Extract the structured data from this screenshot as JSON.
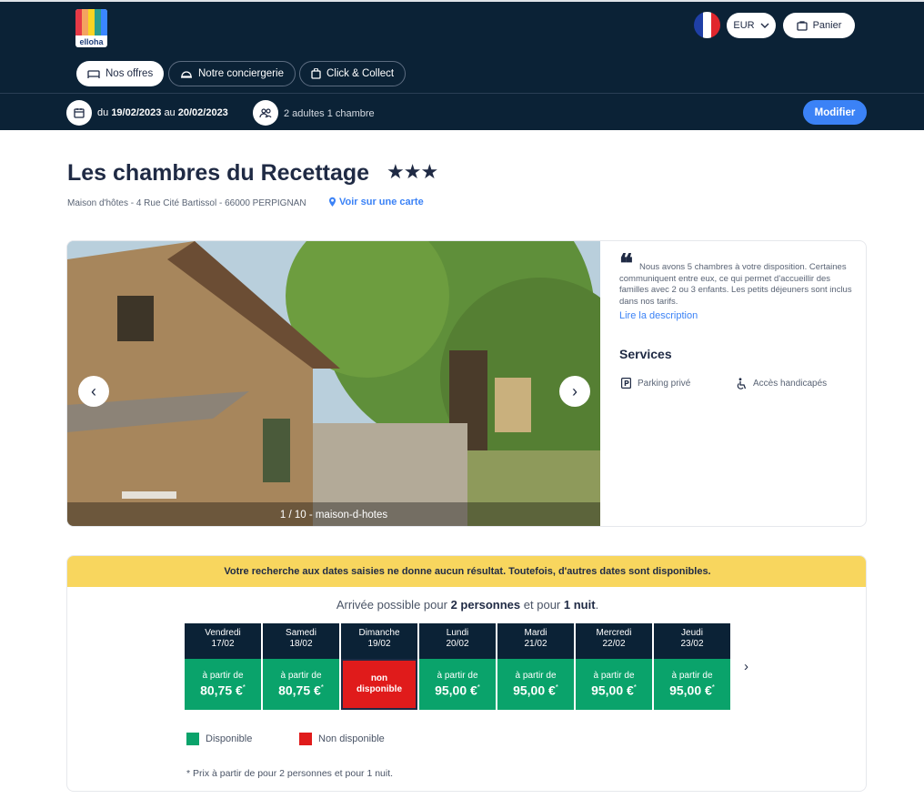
{
  "header": {
    "logo_text": "elloha",
    "currency": "EUR",
    "cart_label": "Panier",
    "nav": [
      {
        "label": "Nos offres"
      },
      {
        "label": "Notre conciergerie"
      },
      {
        "label": "Click & Collect"
      }
    ],
    "search": {
      "date_prefix": "du",
      "date_from": "19/02/2023",
      "date_sep": "au",
      "date_to": "20/02/2023",
      "guests": "2 adultes 1 chambre",
      "modify_label": "Modifier"
    }
  },
  "property": {
    "name": "Les chambres du Recettage",
    "stars": "★★★",
    "address": "Maison d'hôtes - 4 Rue Cité Bartissol - 66000 PERPIGNAN",
    "map_link": "Voir sur une carte",
    "photo_caption": "1 / 10 - maison-d-hotes",
    "description": "Nous avons 5 chambres à votre disposition. Certaines communiquent entre eux, ce qui permet d'accueillir des familles avec 2 ou 3 enfants. Les petits déjeuners sont inclus dans nos tarifs.",
    "read_more": "Lire la description",
    "services_title": "Services",
    "services": [
      {
        "label": "Parking privé",
        "icon": "parking-icon"
      },
      {
        "label": "Accès handicapés",
        "icon": "accessibility-icon"
      }
    ]
  },
  "availability": {
    "banner": "Votre recherche aux dates saisies ne donne aucun résultat. Toutefois, d'autres dates sont disponibles.",
    "arrival_prefix": "Arrivée possible pour",
    "arrival_people": "2 personnes",
    "arrival_mid": "et pour",
    "arrival_nights": "1 nuit",
    "arrival_suffix": ".",
    "days": [
      {
        "weekday": "Vendredi",
        "date": "17/02",
        "from": "à partir de",
        "price": "80,75 €",
        "mark": "*",
        "available": true
      },
      {
        "weekday": "Samedi",
        "date": "18/02",
        "from": "à partir de",
        "price": "80,75 €",
        "mark": "*",
        "available": true
      },
      {
        "weekday": "Dimanche",
        "date": "19/02",
        "na_line1": "non",
        "na_line2": "disponible",
        "available": false
      },
      {
        "weekday": "Lundi",
        "date": "20/02",
        "from": "à partir de",
        "price": "95,00 €",
        "mark": "*",
        "available": true
      },
      {
        "weekday": "Mardi",
        "date": "21/02",
        "from": "à partir de",
        "price": "95,00 €",
        "mark": "*",
        "available": true
      },
      {
        "weekday": "Mercredi",
        "date": "22/02",
        "from": "à partir de",
        "price": "95,00 €",
        "mark": "*",
        "available": true
      },
      {
        "weekday": "Jeudi",
        "date": "23/02",
        "from": "à partir de",
        "price": "95,00 €",
        "mark": "*",
        "available": true
      }
    ],
    "legend_available": "Disponible",
    "legend_unavailable": "Non disponible",
    "footnote": "* Prix à partir de pour 2 personnes et pour 1 nuit.",
    "colors": {
      "available": "#0aa36b",
      "unavailable": "#e01b1b",
      "banner": "#f8d65e"
    }
  }
}
